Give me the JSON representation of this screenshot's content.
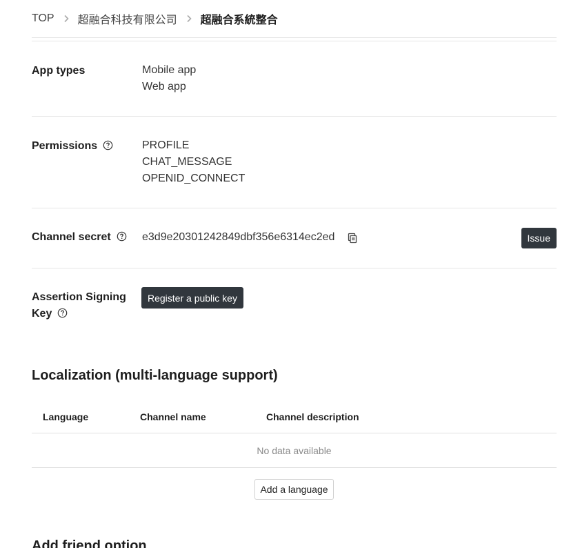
{
  "breadcrumb": {
    "items": [
      "TOP",
      "超融合科技有限公司",
      "超融合系統整合"
    ]
  },
  "app_types": {
    "label": "App types",
    "values": [
      "Mobile app",
      "Web app"
    ]
  },
  "permissions": {
    "label": "Permissions",
    "values": [
      "PROFILE",
      "CHAT_MESSAGE",
      "OPENID_CONNECT"
    ]
  },
  "channel_secret": {
    "label": "Channel secret",
    "value": "e3d9e20301242849dbf356e6314ec2ed",
    "issue_label": "Issue"
  },
  "assertion_key": {
    "label_line1": "Assertion Signing",
    "label_line2": "Key",
    "register_label": "Register a public key"
  },
  "localization": {
    "title": "Localization (multi-language support)",
    "columns": [
      "Language",
      "Channel name",
      "Channel description"
    ],
    "empty_text": "No data available",
    "add_label": "Add a language"
  },
  "next_section": {
    "title": "Add friend option"
  },
  "icons": {
    "chevron": "chevron-right-icon",
    "help": "help-circle-icon",
    "copy": "copy-icon"
  }
}
